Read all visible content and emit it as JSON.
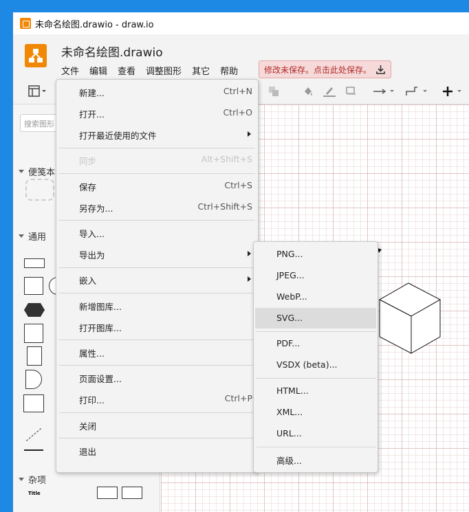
{
  "window": {
    "title": "未命名绘图.drawio - draw.io"
  },
  "header": {
    "doc_title": "未命名绘图.drawio",
    "menus": [
      "文件",
      "编辑",
      "查看",
      "调整图形",
      "其它",
      "帮助"
    ],
    "save_warning": "修改未保存。点击此处保存。"
  },
  "sidebar": {
    "search_placeholder": "搜索图形",
    "sections": [
      "便笺本",
      "通用",
      "杂项"
    ],
    "misc_sample_title": "Title"
  },
  "file_menu": {
    "items": [
      {
        "label": "新建...",
        "shortcut": "Ctrl+N"
      },
      {
        "label": "打开...",
        "shortcut": "Ctrl+O"
      },
      {
        "label": "打开最近使用的文件",
        "shortcut": ""
      },
      {
        "label": "同步",
        "shortcut": "Alt+Shift+S"
      },
      {
        "label": "保存",
        "shortcut": "Ctrl+S"
      },
      {
        "label": "另存为...",
        "shortcut": "Ctrl+Shift+S"
      },
      {
        "label": "导入...",
        "shortcut": ""
      },
      {
        "label": "导出为",
        "shortcut": ""
      },
      {
        "label": "嵌入",
        "shortcut": ""
      },
      {
        "label": "新增图库...",
        "shortcut": ""
      },
      {
        "label": "打开图库...",
        "shortcut": ""
      },
      {
        "label": "属性...",
        "shortcut": ""
      },
      {
        "label": "页面设置...",
        "shortcut": ""
      },
      {
        "label": "打印...",
        "shortcut": "Ctrl+P"
      },
      {
        "label": "关闭",
        "shortcut": ""
      },
      {
        "label": "退出",
        "shortcut": ""
      }
    ]
  },
  "export_menu": {
    "items": [
      "PNG...",
      "JPEG...",
      "WebP...",
      "SVG...",
      "PDF...",
      "VSDX (beta)...",
      "HTML...",
      "XML...",
      "URL...",
      "高级..."
    ],
    "highlighted": "SVG..."
  },
  "colors": {
    "brand": "#f08705",
    "desktop": "#1e88e5",
    "warning_bg": "#f6d9d9",
    "warning_text": "#b12a2a"
  }
}
